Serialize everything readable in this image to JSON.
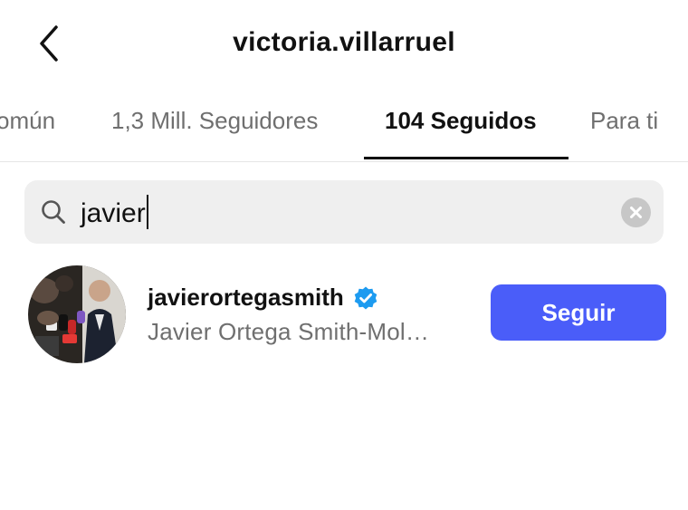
{
  "header": {
    "title": "victoria.villarruel",
    "back_icon": "chevron-left-icon"
  },
  "tabs": [
    {
      "label": "omún"
    },
    {
      "label": "1,3 Mill. Seguidores"
    },
    {
      "label": "104 Seguidos",
      "active": true
    },
    {
      "label": "Para ti"
    }
  ],
  "search": {
    "value": "javier",
    "search_icon": "search-icon",
    "clear_icon": "clear-icon"
  },
  "results": [
    {
      "username": "javierortegasmith",
      "verified": true,
      "full_name": "Javier Ortega Smith-Mol…",
      "button_label": "Seguir"
    }
  ],
  "colors": {
    "accent": "#4a5df9",
    "verified": "#1d9bf0",
    "secondary_text": "#6f6f6f"
  }
}
